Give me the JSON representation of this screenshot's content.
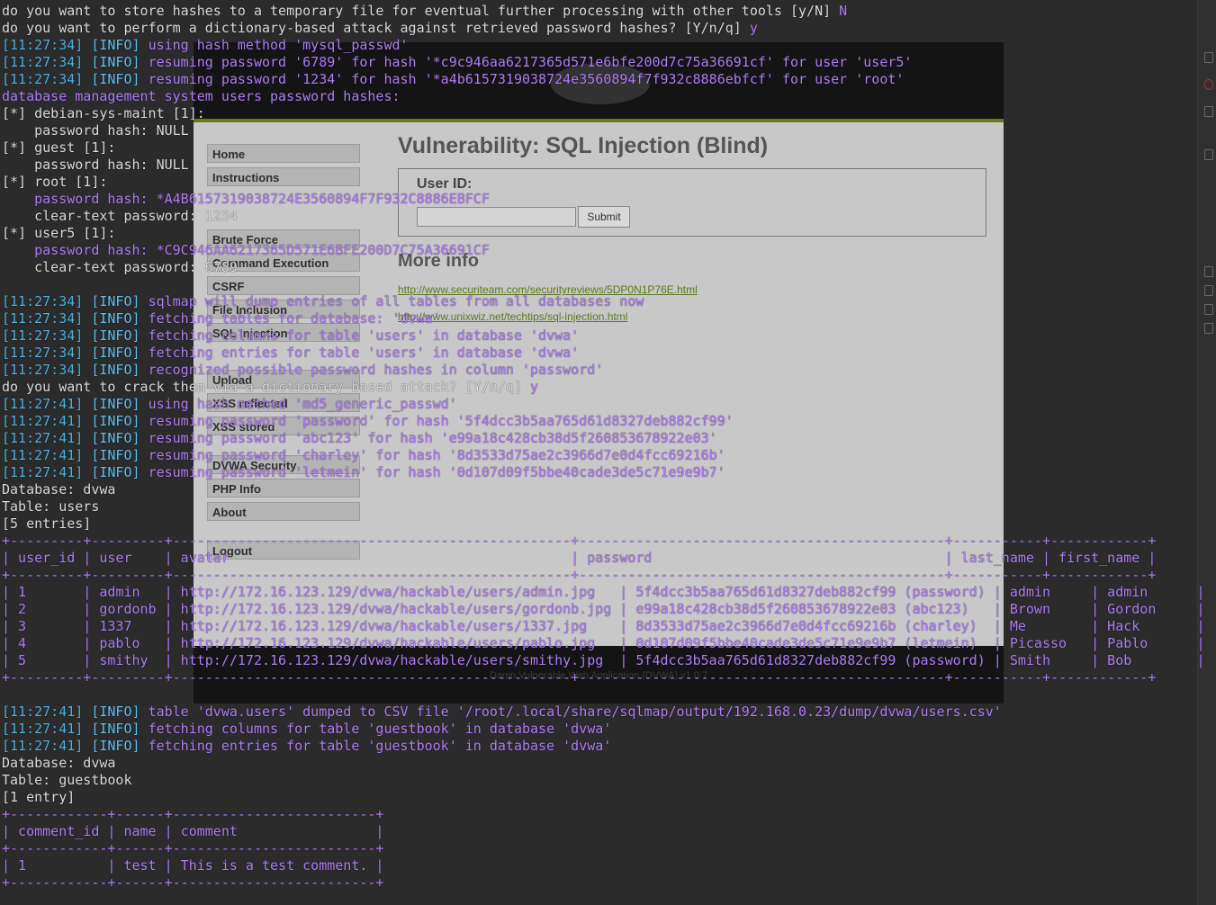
{
  "background_browser": {
    "heading": "Vulnerability: SQL Injection (Blind)",
    "user_id_label": "User ID:",
    "submit_label": "Submit",
    "more_info_heading": "More info",
    "links": [
      "http://www.securiteam.com/securityreviews/5DP0N1P76E.html",
      "http://www.unixwiz.net/techtips/sql-injection.html"
    ],
    "menu_items": [
      "Home",
      "Instructions",
      "Brute Force",
      "Command Execution",
      "CSRF",
      "File Inclusion",
      "SQL Injection",
      "Upload",
      "XSS reflected",
      "XSS stored",
      "DVWA Security",
      "PHP Info",
      "About",
      "Logout"
    ],
    "footer": "Damn Vulnerable Web Application (DVWA) v1.0.7"
  },
  "colors": {
    "terminal_text": "#dcdcdc",
    "timestamp": "#4fb3e0",
    "info_tag": "#5ec2ee",
    "message": "#b07ef7",
    "table": "#b07ef7"
  },
  "terminal": {
    "lines": [
      {
        "type": "prompt",
        "text": "do you want to store hashes to a temporary file for eventual further processing with other tools [y/N] ",
        "answer": "N"
      },
      {
        "type": "prompt",
        "text": "do you want to perform a dictionary-based attack against retrieved password hashes? [Y/n/q] ",
        "answer": "y"
      },
      {
        "type": "log",
        "ts": "[11:27:34]",
        "tag": "[INFO]",
        "msg": "using hash method 'mysql_passwd'"
      },
      {
        "type": "log",
        "ts": "[11:27:34]",
        "tag": "[INFO]",
        "msg": "resuming password '6789' for hash '*c9c946aa6217365d571e6bfe200d7c75a36691cf' for user 'user5'"
      },
      {
        "type": "log",
        "ts": "[11:27:34]",
        "tag": "[INFO]",
        "msg": "resuming password '1234' for hash '*a4b6157319038724e3560894f7f932c8886ebfcf' for user 'root'"
      },
      {
        "type": "msg",
        "text": "database management system users password hashes:"
      },
      {
        "type": "plain",
        "text": "[*] debian-sys-maint [1]:"
      },
      {
        "type": "plain",
        "text": "    password hash: NULL"
      },
      {
        "type": "plain",
        "text": "[*] guest [1]:"
      },
      {
        "type": "plain",
        "text": "    password hash: NULL"
      },
      {
        "type": "plain",
        "text": "[*] root [1]:"
      },
      {
        "type": "msg",
        "text": "    password hash: *A4B6157319038724E3560894F7F932C8886EBFCF"
      },
      {
        "type": "plain",
        "text": "    clear-text password: 1234"
      },
      {
        "type": "plain",
        "text": "[*] user5 [1]:"
      },
      {
        "type": "msg",
        "text": "    password hash: *C9C946AA6217365D571E6BFE200D7C75A36691CF"
      },
      {
        "type": "plain",
        "text": "    clear-text password: 6789"
      },
      {
        "type": "plain",
        "text": ""
      },
      {
        "type": "log",
        "ts": "[11:27:34]",
        "tag": "[INFO]",
        "msg": "sqlmap will dump entries of all tables from all databases now"
      },
      {
        "type": "log",
        "ts": "[11:27:34]",
        "tag": "[INFO]",
        "msg": "fetching tables for database: 'dvwa'"
      },
      {
        "type": "log",
        "ts": "[11:27:34]",
        "tag": "[INFO]",
        "msg": "fetching columns for table 'users' in database 'dvwa'"
      },
      {
        "type": "log",
        "ts": "[11:27:34]",
        "tag": "[INFO]",
        "msg": "fetching entries for table 'users' in database 'dvwa'"
      },
      {
        "type": "log",
        "ts": "[11:27:34]",
        "tag": "[INFO]",
        "msg": "recognized possible password hashes in column 'password'"
      },
      {
        "type": "prompt",
        "text": "do you want to crack them via a dictionary-based attack? [Y/n/q] ",
        "answer": "y"
      },
      {
        "type": "log",
        "ts": "[11:27:41]",
        "tag": "[INFO]",
        "msg": "using hash method 'md5_generic_passwd'"
      },
      {
        "type": "log",
        "ts": "[11:27:41]",
        "tag": "[INFO]",
        "msg": "resuming password 'password' for hash '5f4dcc3b5aa765d61d8327deb882cf99'"
      },
      {
        "type": "log",
        "ts": "[11:27:41]",
        "tag": "[INFO]",
        "msg": "resuming password 'abc123' for hash 'e99a18c428cb38d5f260853678922e03'"
      },
      {
        "type": "log",
        "ts": "[11:27:41]",
        "tag": "[INFO]",
        "msg": "resuming password 'charley' for hash '8d3533d75ae2c3966d7e0d4fcc69216b'"
      },
      {
        "type": "log",
        "ts": "[11:27:41]",
        "tag": "[INFO]",
        "msg": "resuming password 'letmein' for hash '0d107d09f5bbe40cade3de5c71e9e9b7'"
      },
      {
        "type": "plain",
        "text": "Database: dvwa"
      },
      {
        "type": "plain",
        "text": "Table: users"
      },
      {
        "type": "plain",
        "text": "[5 entries]"
      },
      {
        "type": "table",
        "text": "+---------+---------+-------------------------------------------------+---------------------------------------------+-----------+------------+"
      },
      {
        "type": "table",
        "text": "| user_id | user    | avatar                                          | password                                    | last_name | first_name |"
      },
      {
        "type": "table",
        "text": "+---------+---------+-------------------------------------------------+---------------------------------------------+-----------+------------+"
      },
      {
        "type": "table",
        "text": "| 1       | admin   | http://172.16.123.129/dvwa/hackable/users/admin.jpg   | 5f4dcc3b5aa765d61d8327deb882cf99 (password) | admin     | admin      |"
      },
      {
        "type": "table",
        "text": "| 2       | gordonb | http://172.16.123.129/dvwa/hackable/users/gordonb.jpg | e99a18c428cb38d5f260853678922e03 (abc123)   | Brown     | Gordon     |"
      },
      {
        "type": "table",
        "text": "| 3       | 1337    | http://172.16.123.129/dvwa/hackable/users/1337.jpg    | 8d3533d75ae2c3966d7e0d4fcc69216b (charley)  | Me        | Hack       |"
      },
      {
        "type": "table",
        "text": "| 4       | pablo   | http://172.16.123.129/dvwa/hackable/users/pablo.jpg   | 0d107d09f5bbe40cade3de5c71e9e9b7 (letmein)  | Picasso   | Pablo      |"
      },
      {
        "type": "table",
        "text": "| 5       | smithy  | http://172.16.123.129/dvwa/hackable/users/smithy.jpg  | 5f4dcc3b5aa765d61d8327deb882cf99 (password) | Smith     | Bob        |"
      },
      {
        "type": "table",
        "text": "+---------+---------+-------------------------------------------------+---------------------------------------------+-----------+------------+"
      },
      {
        "type": "plain",
        "text": ""
      },
      {
        "type": "log",
        "ts": "[11:27:41]",
        "tag": "[INFO]",
        "msg": "table 'dvwa.users' dumped to CSV file '/root/.local/share/sqlmap/output/192.168.0.23/dump/dvwa/users.csv'"
      },
      {
        "type": "log",
        "ts": "[11:27:41]",
        "tag": "[INFO]",
        "msg": "fetching columns for table 'guestbook' in database 'dvwa'"
      },
      {
        "type": "log",
        "ts": "[11:27:41]",
        "tag": "[INFO]",
        "msg": "fetching entries for table 'guestbook' in database 'dvwa'"
      },
      {
        "type": "plain",
        "text": "Database: dvwa"
      },
      {
        "type": "plain",
        "text": "Table: guestbook"
      },
      {
        "type": "plain",
        "text": "[1 entry]"
      },
      {
        "type": "table",
        "text": "+------------+------+-------------------------+"
      },
      {
        "type": "table",
        "text": "| comment_id | name | comment                 |"
      },
      {
        "type": "table",
        "text": "+------------+------+-------------------------+"
      },
      {
        "type": "table",
        "text": "| 1          | test | This is a test comment. |"
      },
      {
        "type": "table",
        "text": "+------------+------+-------------------------+"
      }
    ]
  }
}
